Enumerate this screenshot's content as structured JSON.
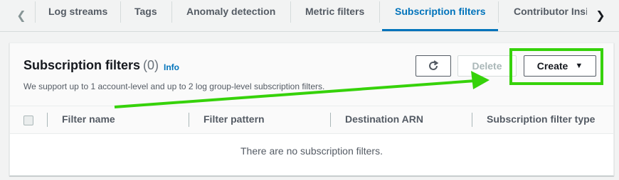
{
  "tabs": {
    "items": [
      {
        "label": "Log streams"
      },
      {
        "label": "Tags"
      },
      {
        "label": "Anomaly detection"
      },
      {
        "label": "Metric filters"
      },
      {
        "label": "Subscription filters"
      },
      {
        "label": "Contributor Insi"
      }
    ],
    "active": "Subscription filters"
  },
  "panel": {
    "title": "Subscription filters",
    "count": "(0)",
    "info_label": "Info",
    "description": "We support up to 1 account-level and up to 2 log group-level subscription filters.",
    "buttons": {
      "delete_label": "Delete",
      "create_label": "Create"
    }
  },
  "table": {
    "columns": [
      "Filter name",
      "Filter pattern",
      "Destination ARN",
      "Subscription filter type"
    ],
    "empty_message": "There are no subscription filters."
  },
  "annotation": {
    "color": "#36d20a"
  }
}
